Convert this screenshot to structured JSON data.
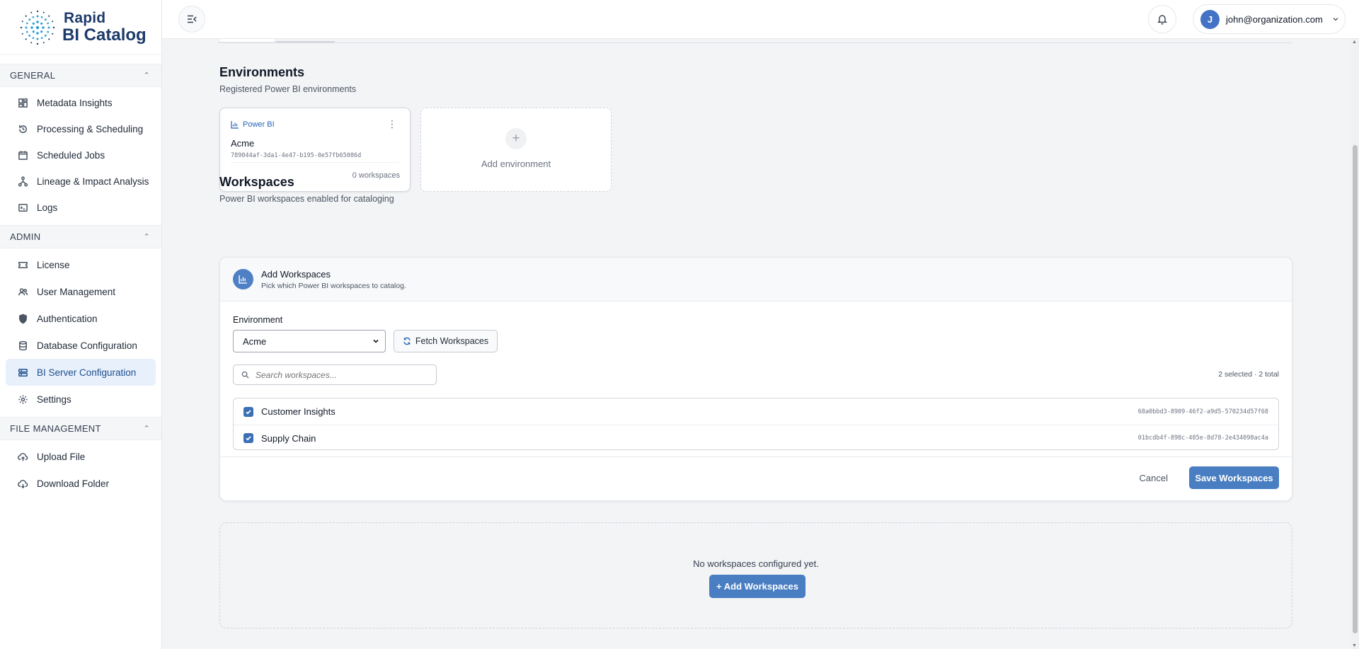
{
  "brand": {
    "line1": "Rapid",
    "line2": "BI Catalog"
  },
  "sidebar": {
    "sections": [
      {
        "title": "GENERAL",
        "items": [
          {
            "label": "Metadata Insights",
            "icon": "dashboard-icon"
          },
          {
            "label": "Processing & Scheduling",
            "icon": "refresh-clock-icon"
          },
          {
            "label": "Scheduled Jobs",
            "icon": "calendar-icon"
          },
          {
            "label": "Lineage & Impact Analysis",
            "icon": "lineage-icon"
          },
          {
            "label": "Logs",
            "icon": "terminal-icon"
          }
        ]
      },
      {
        "title": "ADMIN",
        "items": [
          {
            "label": "License",
            "icon": "ticket-icon"
          },
          {
            "label": "User Management",
            "icon": "users-icon"
          },
          {
            "label": "Authentication",
            "icon": "shield-icon"
          },
          {
            "label": "Database Configuration",
            "icon": "database-icon"
          },
          {
            "label": "BI Server Configuration",
            "icon": "server-icon",
            "active": true
          },
          {
            "label": "Settings",
            "icon": "gear-icon"
          }
        ]
      },
      {
        "title": "FILE MANAGEMENT",
        "items": [
          {
            "label": "Upload File",
            "icon": "cloud-upload-icon"
          },
          {
            "label": "Download Folder",
            "icon": "cloud-download-icon"
          }
        ]
      }
    ]
  },
  "topbar": {
    "user_initial": "J",
    "user_email": "john@organization.com"
  },
  "environments": {
    "title": "Environments",
    "subtitle": "Registered Power BI environments",
    "cards": [
      {
        "type": "Power BI",
        "name": "Acme",
        "id": "789044af-3da1-4e47-b195-0e57fb65086d",
        "count": "0 workspaces"
      }
    ],
    "add_label": "Add environment"
  },
  "workspaces": {
    "title": "Workspaces",
    "subtitle": "Power BI workspaces enabled for cataloging",
    "panel": {
      "title": "Add Workspaces",
      "subtitle": "Pick which Power BI workspaces to catalog.",
      "env_label": "Environment",
      "env_selected": "Acme",
      "fetch_label": "Fetch Workspaces",
      "search_placeholder": "Search workspaces...",
      "selection_count": "2 selected · 2 total",
      "rows": [
        {
          "name": "Customer Insights",
          "id": "68a0bbd3-8909-46f2-a9d5-570234d57f68",
          "checked": true
        },
        {
          "name": "Supply Chain",
          "id": "01bcdb4f-898c-485e-8d78-2e434098ac4a",
          "checked": true
        }
      ],
      "cancel_label": "Cancel",
      "save_label": "Save Workspaces"
    },
    "empty_message": "No workspaces configured yet.",
    "empty_button": "+ Add Workspaces"
  },
  "colors": {
    "accent": "#4a7ec2",
    "brand": "#1d3a6b",
    "active_bg": "#e8f0fb"
  }
}
